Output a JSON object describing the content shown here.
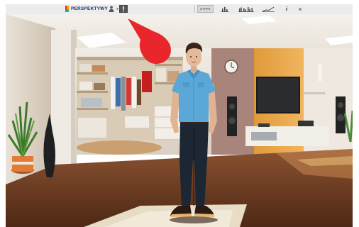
{
  "toolbar": {
    "logo_text": "PERSPEKTYWY",
    "start_label": "START",
    "info_label": "i",
    "close_label": "×"
  },
  "icons": [
    "user-icon",
    "dot-icon",
    "exclamation-icon",
    "bar-chart-icon",
    "group-bars-icon",
    "trend-line-icon",
    "info-icon",
    "close-icon"
  ],
  "colors": {
    "toolbar_bg": "#ececec",
    "logo_text": "#1b2f6e",
    "pointer_red": "#e8262c",
    "floor": "#6b3a22",
    "shirt": "#5aa7d8",
    "jeans": "#1d2633"
  }
}
